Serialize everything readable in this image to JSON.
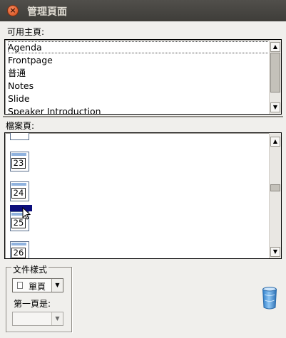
{
  "window": {
    "title": "管理頁面"
  },
  "available_pages": {
    "label": "可用主頁:",
    "items": [
      "Agenda",
      "Frontpage",
      "普通",
      "Notes",
      "Slide",
      "Speaker Introduction"
    ],
    "selected": "Agenda"
  },
  "document_pages": {
    "label": "檔案頁:",
    "visible_pages": [
      "23",
      "24",
      "25",
      "26"
    ],
    "selected_after": "24"
  },
  "document_style": {
    "group_label": "文件樣式",
    "layout_value": "單頁",
    "first_page_label": "第一頁是:",
    "first_page_value": ""
  },
  "icons": {
    "close": "close-icon",
    "trash": "trash-icon",
    "layout": "single-page-icon"
  },
  "colors": {
    "titlebar": "#3e3d39",
    "close_button": "#e6632f",
    "selection": "#0b0d7c",
    "page_header": "#8fb2de",
    "trash": "#3b90d8"
  }
}
